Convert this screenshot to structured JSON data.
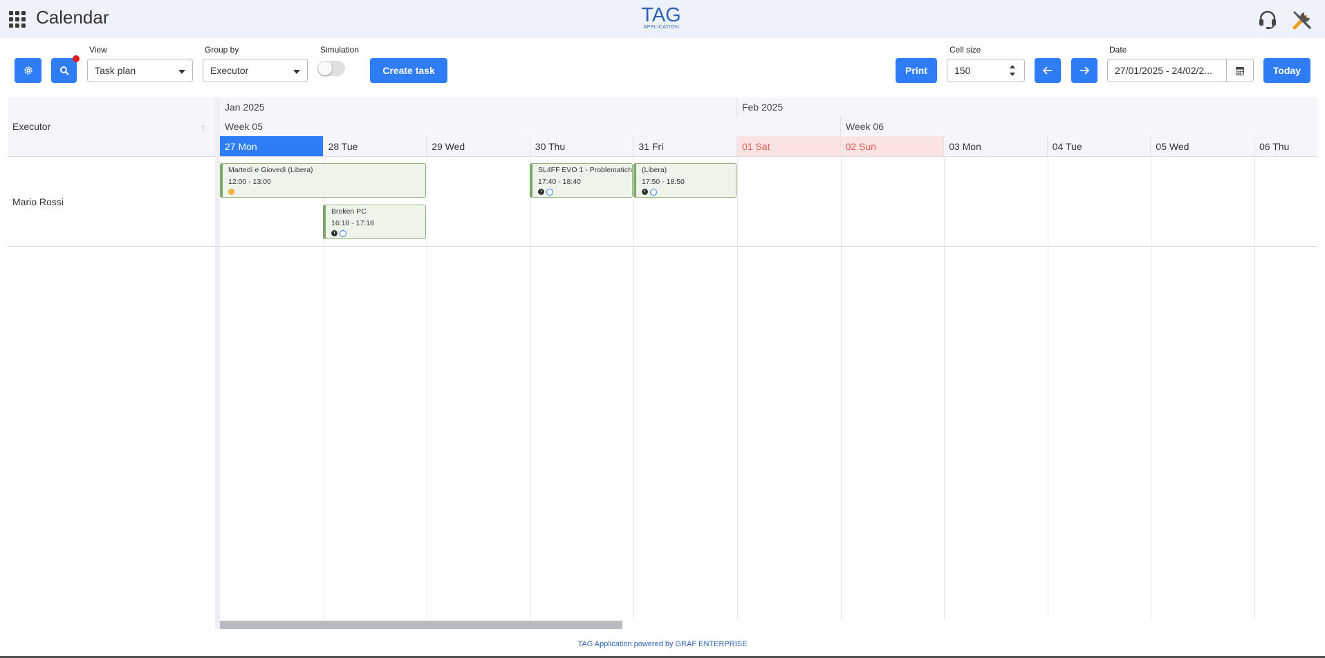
{
  "app": {
    "title": "Calendar",
    "logo_main": "TAG",
    "logo_sub": "APPLICATION"
  },
  "toolbar": {
    "view_label": "View",
    "view_value": "Task plan",
    "group_by_label": "Group by",
    "group_by_value": "Executor",
    "simulation_label": "Simulation",
    "simulation_on": false,
    "create_task": "Create task",
    "print": "Print",
    "cell_size_label": "Cell size",
    "cell_size_value": "150",
    "date_label": "Date",
    "date_value": "27/01/2025 - 24/02/2...",
    "today": "Today"
  },
  "grid": {
    "left_header": "Executor",
    "months": [
      {
        "label": "Jan 2025"
      },
      {
        "label": "Feb 2025"
      }
    ],
    "weeks": [
      {
        "label": "Week 05"
      },
      {
        "label": "Week 06"
      }
    ],
    "days": [
      "27 Mon",
      "28 Tue",
      "29 Wed",
      "30 Thu",
      "31 Fri",
      "01 Sat",
      "02 Sun",
      "03 Mon",
      "04 Tue",
      "05 Wed",
      "06 Thu"
    ],
    "today_index": 0,
    "weekend_indices": [
      5,
      6
    ],
    "executors": [
      "Mario Rossi"
    ]
  },
  "tasks": [
    {
      "title": "Martedì e Giovedì (Libera)",
      "time": "12:00 - 13:00",
      "icons": [
        "sun"
      ]
    },
    {
      "title": "Broken PC",
      "time": "16:18 - 17:18",
      "icons": [
        "clock",
        "circle"
      ]
    },
    {
      "title": "SL4FF EVO 1 - Problematich",
      "time": "17:40 - 18:40",
      "icons": [
        "clock",
        "circle"
      ]
    },
    {
      "title": "(Libera)",
      "time": "17:50 - 18:50",
      "icons": [
        "clock",
        "circle"
      ]
    }
  ],
  "footer": "TAG Application powered by GRAF ENTERPRISE",
  "colors": {
    "accent": "#2e7cf6",
    "weekend": "#e05656",
    "task_border": "#7ba86a"
  }
}
